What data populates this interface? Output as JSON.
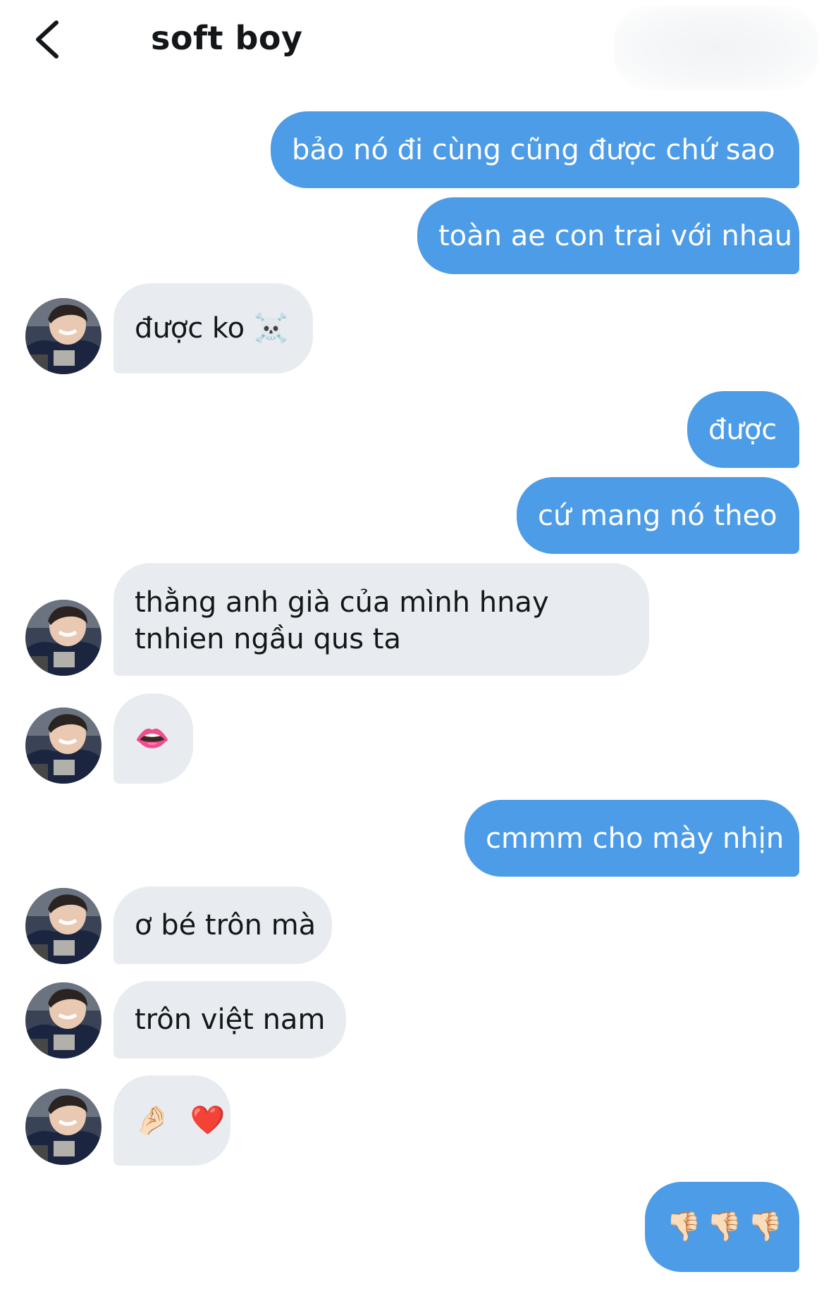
{
  "header": {
    "back_icon": "chevron-left-icon",
    "title": "soft boy"
  },
  "messages": [
    {
      "id": "m1",
      "side": "sent",
      "text": "bảo nó đi cùng cũng được chứ sao"
    },
    {
      "id": "m2",
      "side": "sent",
      "text": "toàn ae con trai với nhau"
    },
    {
      "id": "m3",
      "side": "received",
      "text": "được ko ☠️"
    },
    {
      "id": "m4",
      "side": "sent",
      "text": "được"
    },
    {
      "id": "m5",
      "side": "sent",
      "text": "cứ mang nó theo"
    },
    {
      "id": "m6",
      "side": "received",
      "text": "thằng anh già của mình hnay tnhien ngầu qus ta"
    },
    {
      "id": "m7",
      "side": "received",
      "text": "👄"
    },
    {
      "id": "m8",
      "side": "sent",
      "text": "cmmm cho mày nhịn"
    },
    {
      "id": "m9",
      "side": "received",
      "text": "ơ bé trôn mà"
    },
    {
      "id": "m10",
      "side": "received",
      "text": "trôn việt nam"
    },
    {
      "id": "m11",
      "side": "received",
      "text": "🤌🏻 ❤️"
    },
    {
      "id": "m12",
      "side": "sent",
      "text": "👎🏻👎🏻👎🏻"
    }
  ],
  "colors": {
    "sent_bubble": "#4d9ce8",
    "received_bubble": "#e8ecf0",
    "avatar_bg": "#1f2a44"
  }
}
